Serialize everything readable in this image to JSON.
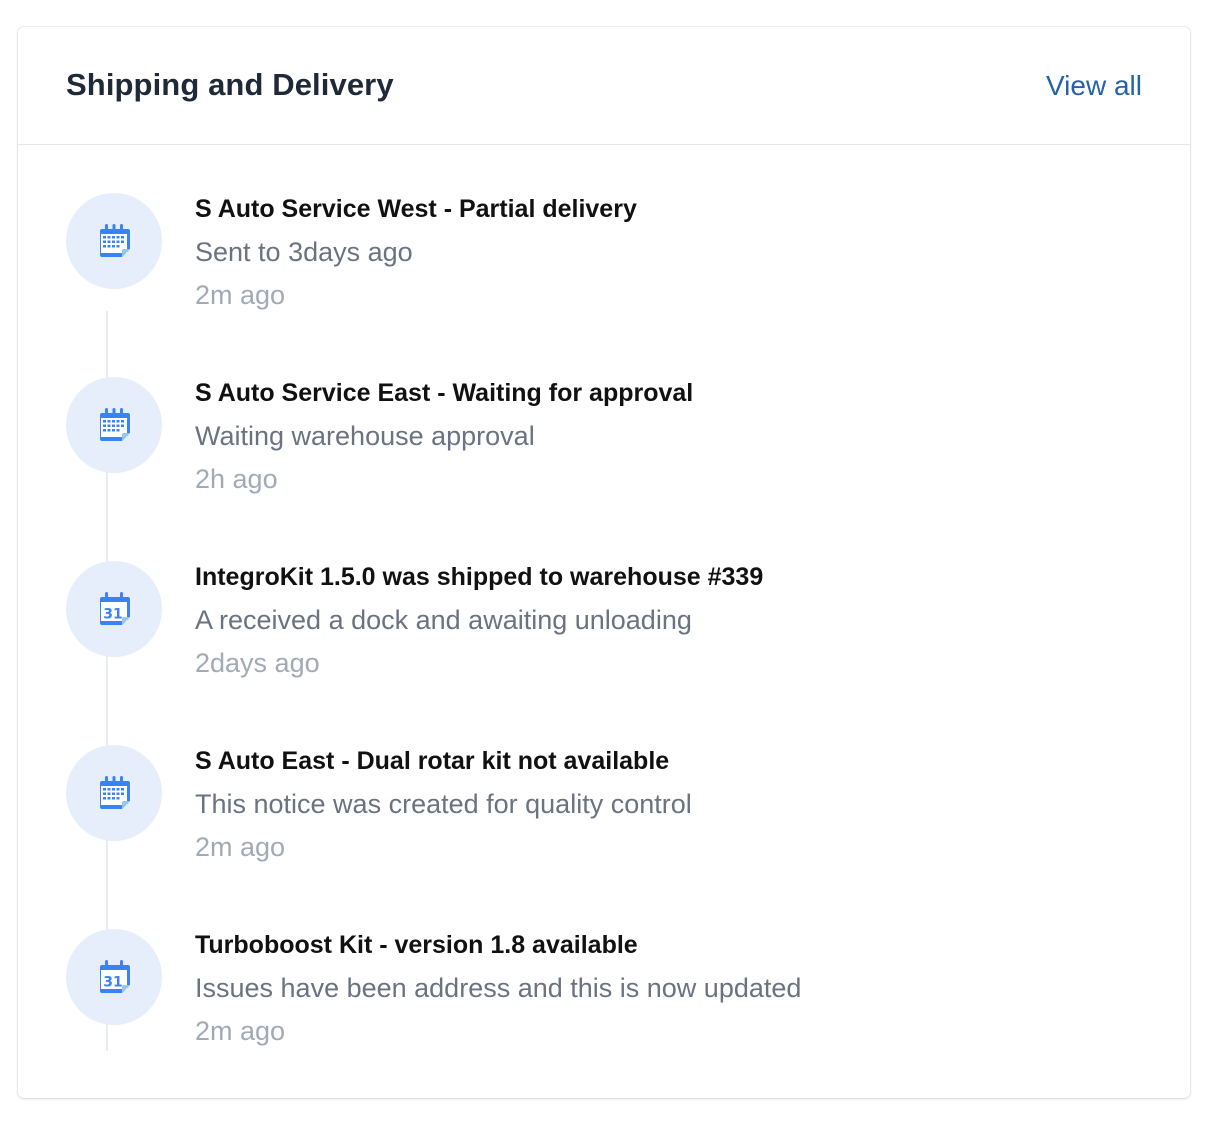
{
  "header": {
    "title": "Shipping and Delivery",
    "view_all_label": "View all"
  },
  "accent_color": "#2563a8",
  "icon_color": "#3b82f6",
  "items": [
    {
      "icon": "calendar-grid-icon",
      "title": "S Auto Service West - Partial delivery",
      "description": "Sent to 3days ago",
      "time": "2m ago"
    },
    {
      "icon": "calendar-grid-icon",
      "title": "S Auto Service East - Waiting for approval",
      "description": "Waiting warehouse approval",
      "time": "2h ago"
    },
    {
      "icon": "calendar-31-icon",
      "title": "IntegroKit 1.5.0 was shipped to warehouse #339",
      "description": "A received a dock and awaiting unloading",
      "time": "2days ago"
    },
    {
      "icon": "calendar-grid-icon",
      "title": "S Auto East - Dual rotar kit not available",
      "description": "This notice was created for quality control",
      "time": "2m ago"
    },
    {
      "icon": "calendar-31-icon",
      "title": "Turboboost Kit - version 1.8 available",
      "description": "Issues have been address and this is now updated",
      "time": "2m ago"
    }
  ]
}
